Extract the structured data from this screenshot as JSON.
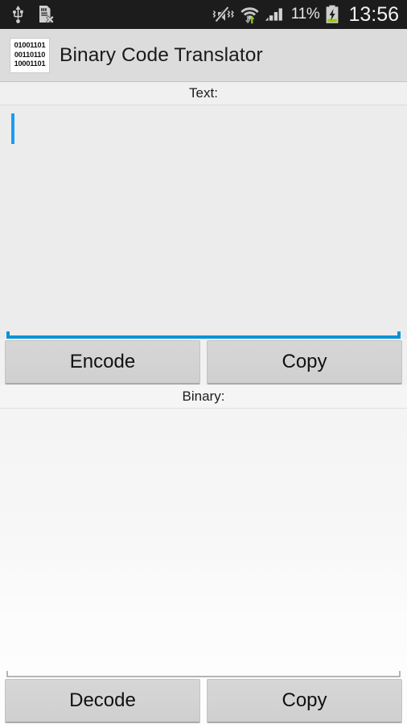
{
  "status_bar": {
    "left_icons": [
      {
        "name": "usb-icon",
        "label": "USB connected"
      },
      {
        "name": "sd-card-removed-icon",
        "label": "SD card removed"
      }
    ],
    "right_icons": [
      {
        "name": "volume-mute-vibrate-icon",
        "label": "Silent / vibrate"
      },
      {
        "name": "wifi-transfer-icon",
        "label": "Wi-Fi active"
      },
      {
        "name": "cellular-signal-icon",
        "label": "Mobile signal"
      }
    ],
    "battery_percent": "11%",
    "battery_icon": "battery-charging-icon",
    "clock": "13:56",
    "background_color": "#1c1c1c",
    "text_color": "#f2f2f2",
    "battery_accent_color": "#99cc00"
  },
  "action_bar": {
    "icon_name": "binary-app-icon",
    "icon_lines": [
      "01001101",
      "00110110",
      "10001101"
    ],
    "title": "Binary Code Translator",
    "background_color": "#dcdcdc"
  },
  "text_section": {
    "label": "Text:",
    "field": {
      "name": "text-input",
      "value": "",
      "placeholder": "",
      "focused": true,
      "underline_color": "#0c93d8",
      "caret_color": "#1e9bf0"
    },
    "buttons": [
      {
        "name": "encode-button",
        "label": "Encode"
      },
      {
        "name": "copy-text-button",
        "label": "Copy"
      }
    ]
  },
  "binary_section": {
    "label": "Binary:",
    "field": {
      "name": "binary-input",
      "value": "",
      "placeholder": "",
      "focused": false,
      "underline_color": "#b4b4b4"
    },
    "buttons": [
      {
        "name": "decode-button",
        "label": "Decode"
      },
      {
        "name": "copy-binary-button",
        "label": "Copy"
      }
    ]
  },
  "theme": {
    "button_face": "#d3d3d3",
    "page_background": "#f2f2f2",
    "label_background": "#f0f0f0"
  }
}
